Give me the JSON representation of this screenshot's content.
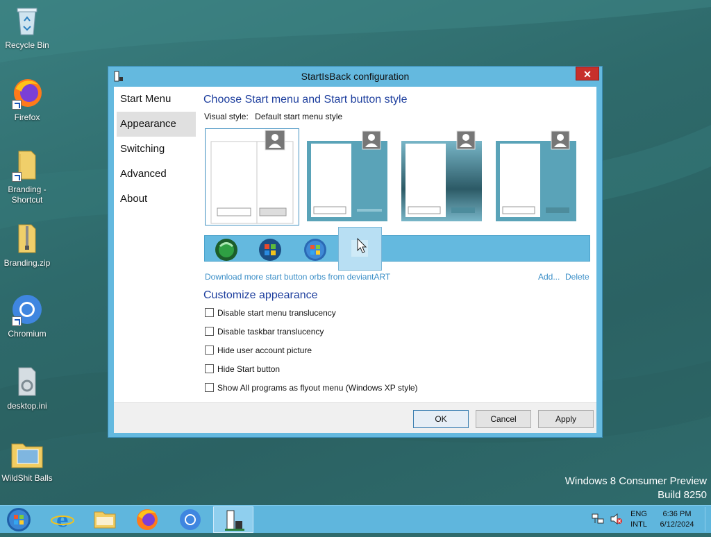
{
  "desktop": {
    "icons": [
      {
        "label": "Recycle Bin"
      },
      {
        "label": "Firefox"
      },
      {
        "label": "Branding -\nShortcut"
      },
      {
        "label": "Branding.zip"
      },
      {
        "label": "Chromium"
      },
      {
        "label": "desktop.ini"
      },
      {
        "label": "WildShit Balls"
      }
    ],
    "watermark_line1": "Windows 8 Consumer Preview",
    "watermark_line2": "Build 8250"
  },
  "window": {
    "title": "StartIsBack configuration",
    "close_label": "✕",
    "nav": [
      "Start Menu",
      "Appearance",
      "Switching",
      "Advanced",
      "About"
    ],
    "selected_nav": "Appearance",
    "heading_style": "Choose Start menu and Start button style",
    "visual_style_label": "Visual style:",
    "visual_style_value": "Default start menu style",
    "download_link": "Download more start button orbs from deviantART",
    "add_link": "Add...",
    "delete_link": "Delete",
    "heading_customize": "Customize appearance",
    "checkboxes": [
      {
        "label": "Disable start menu translucency",
        "checked": false
      },
      {
        "label": "Disable taskbar translucency",
        "checked": false
      },
      {
        "label": "Hide user account picture",
        "checked": false
      },
      {
        "label": "Hide Start button",
        "checked": false
      },
      {
        "label": "Show All programs as flyout menu (Windows XP style)",
        "checked": false
      }
    ],
    "ok_label": "OK",
    "cancel_label": "Cancel",
    "apply_label": "Apply"
  },
  "taskbar": {
    "apps": [
      "start-orb-icon",
      "internet-explorer-icon",
      "file-explorer-icon",
      "firefox-icon",
      "chromium-icon",
      "startisback-icon"
    ],
    "lang_line1": "ENG",
    "lang_line2": "INTL",
    "time": "6:36 PM",
    "date": "6/12/2024"
  },
  "colors": {
    "accent": "#64b9df",
    "taskbar": "#5fb6dd",
    "heading": "#1e3f9e",
    "link": "#3a8ec7",
    "close": "#c7302b"
  }
}
